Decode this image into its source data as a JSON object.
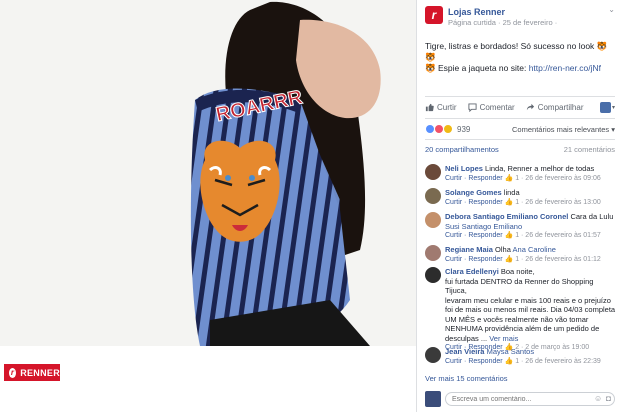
{
  "photo": {
    "patch_text": "ROARRR",
    "brand_logo": "RENNER"
  },
  "post": {
    "page_name": "Lojas Renner",
    "meta": "Página curtida · 25 de fevereiro ·",
    "text_line1": "Tigre, listras e bordados! Só sucesso no look 🐯🐯",
    "text_line2_prefix": "🐯 Espie a jaqueta no site: ",
    "link": "http://ren-ner.co/jNf",
    "actions": {
      "like": "Curtir",
      "comment": "Comentar",
      "share": "Compartilhar"
    },
    "reaction_count": "939",
    "relevance_filter": "Comentários mais relevantes ▾",
    "shares": "20 compartilhamentos",
    "comment_count": "21 comentários"
  },
  "comments": [
    {
      "name": "Neli Lopes",
      "text": "Linda, Renner a melhor de todas",
      "reply": "Curtir · Responder",
      "stats": "👍 1 · 26 de fevereiro às 09:06",
      "avatar_color": "#6b4a3a"
    },
    {
      "name": "Solange Gomes",
      "text": "linda",
      "reply": "Curtir · Responder",
      "stats": "👍 1 · 26 de fevereiro às 13:00",
      "avatar_color": "#7a6a50"
    },
    {
      "name": "Debora Santiago Emiliano Coronel",
      "text": "Cara da Lulu",
      "mention": "Susi Santiago Emiliano",
      "reply": "Curtir · Responder",
      "stats": "👍 1 · 26 de fevereiro às 01:57",
      "avatar_color": "#c4906a"
    },
    {
      "name": "Regiane Maia",
      "text": "Olha",
      "mention": "Ana Caroline",
      "reply": "Curtir · Responder",
      "stats": "👍 1 · 26 de fevereiro às 01:12",
      "avatar_color": "#a07a70"
    },
    {
      "name": "Clara Edellenyi",
      "lines": [
        "Boa noite,",
        "fui furtada DENTRO da Renner do Shopping Tijuca,",
        "levaram meu celular e mais 100 reais e o prejuízo",
        "foi de mais ou menos mil reais. Dia 04/03 completa",
        "UM MÊS e vocês realmente não vão tomar",
        "NENHUMA providência além de um pedido de",
        "desculpas ..."
      ],
      "more": "Ver mais",
      "reply": "Curtir · Responder",
      "stats": "👍 2 · 2 de março às 19:00",
      "avatar_color": "#2c2c2c"
    },
    {
      "name": "Jean Vieira",
      "mention": "Maysa Santos",
      "reply": "Curtir · Responder",
      "stats": "👍 1 · 26 de fevereiro às 22:39",
      "avatar_color": "#3a3a3a"
    }
  ],
  "view_more": "Ver mais 15 comentários",
  "composer_placeholder": "Escreva um comentário...",
  "icons": [
    "renner-logo",
    "like-icon",
    "comment-icon",
    "share-icon",
    "chevron-down-icon",
    "camera-icon",
    "emoji-icon"
  ]
}
